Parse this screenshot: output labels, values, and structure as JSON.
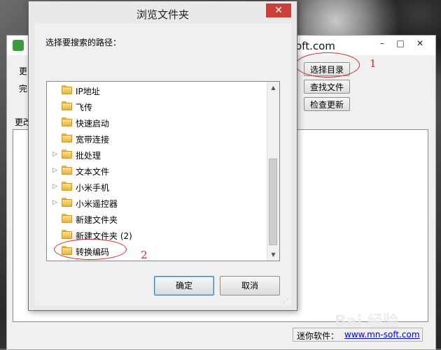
{
  "dialog": {
    "title": "浏览文件夹",
    "close_label": "✕",
    "prompt": "选择要搜索的路径：",
    "ok_label": "确定",
    "cancel_label": "取消",
    "folders": [
      {
        "label": "IP地址",
        "expandable": false
      },
      {
        "label": "飞传",
        "expandable": false
      },
      {
        "label": "快速启动",
        "expandable": false
      },
      {
        "label": "宽带连接",
        "expandable": false
      },
      {
        "label": "批处理",
        "expandable": true
      },
      {
        "label": "文本文件",
        "expandable": true
      },
      {
        "label": "小米手机",
        "expandable": true
      },
      {
        "label": "小米遥控器",
        "expandable": true
      },
      {
        "label": "新建文件夹",
        "expandable": false
      },
      {
        "label": "新建文件夹 (2)",
        "expandable": false
      },
      {
        "label": "转换编码",
        "expandable": false
      }
    ]
  },
  "app": {
    "title": "oft.com",
    "label_1": "更",
    "label_2": "完",
    "label_3": "更改",
    "select_dir_label": "选择目录",
    "find_file_label": "查找文件",
    "check_update_label": "检查更新",
    "minimize": "–",
    "maximize": "□",
    "close": "✕",
    "status_label": "迷你软件：",
    "status_link": "www.mn-soft.com"
  },
  "annotations": {
    "num_1": "1",
    "num_2": "2"
  },
  "watermark": "Bai 经验",
  "colors": {
    "annotation": "#d4282e",
    "close_button": "#c7413a",
    "link": "#0000cc"
  }
}
